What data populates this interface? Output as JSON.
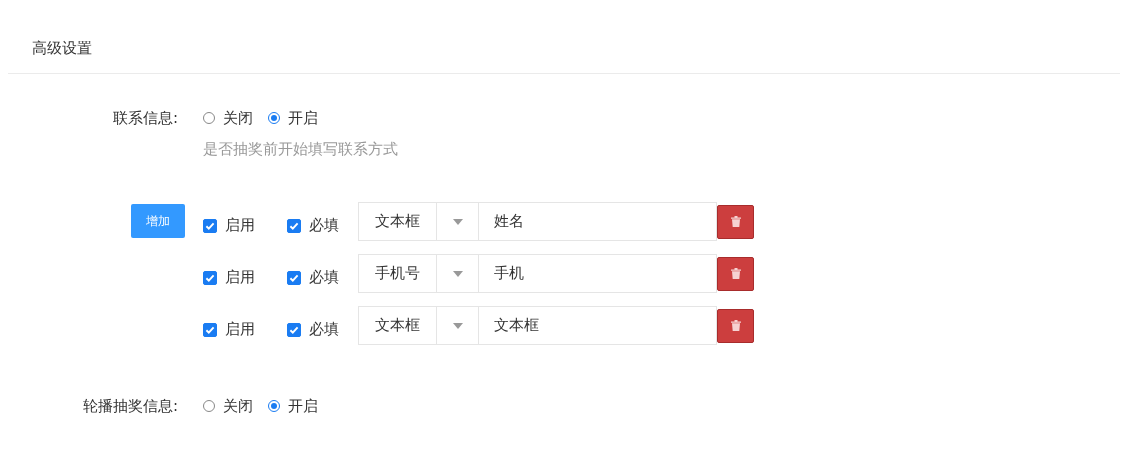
{
  "section_title": "高级设置",
  "contact_info": {
    "label": "联系信息:",
    "options": [
      {
        "label": "关闭",
        "selected": false
      },
      {
        "label": "开启",
        "selected": true
      }
    ],
    "hint": "是否抽奖前开始填写联系方式"
  },
  "add_button": "增加",
  "fields": [
    {
      "enabled": {
        "label": "启用",
        "checked": true
      },
      "required": {
        "label": "必填",
        "checked": true
      },
      "type": "文本框",
      "name": "姓名"
    },
    {
      "enabled": {
        "label": "启用",
        "checked": true
      },
      "required": {
        "label": "必填",
        "checked": true
      },
      "type": "手机号",
      "name": "手机"
    },
    {
      "enabled": {
        "label": "启用",
        "checked": true
      },
      "required": {
        "label": "必填",
        "checked": true
      },
      "type": "文本框",
      "name": "文本框"
    }
  ],
  "carousel_info": {
    "label": "轮播抽奖信息:",
    "options": [
      {
        "label": "关闭",
        "selected": false
      },
      {
        "label": "开启",
        "selected": true
      }
    ]
  }
}
